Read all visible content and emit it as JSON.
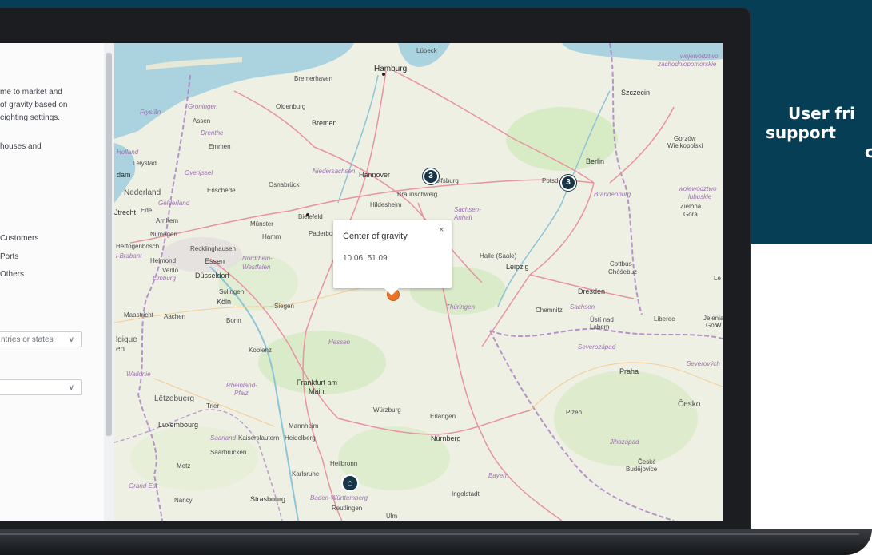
{
  "tagline": {
    "line1": "User fri",
    "line2": "support",
    "line3": "c"
  },
  "sidebar": {
    "desc_lines": [
      "me to market and",
      "of gravity based on",
      "eighting settings."
    ],
    "desc2": "houses and",
    "checkboxes": [
      "Customers",
      "Ports",
      "Others"
    ],
    "select1_placeholder": "ntries or states",
    "select_chevron": "∨"
  },
  "map": {
    "popup": {
      "title": "Center of gravity",
      "coords": "10.06, 51.09",
      "close": "×"
    },
    "clusters": [
      {
        "id": "hannover",
        "count": "3"
      },
      {
        "id": "berlin",
        "count": "3"
      }
    ],
    "icons": {
      "warehouse": "house-icon"
    },
    "labels": {
      "hamburg": "Hamburg",
      "lubeck": "Lübeck",
      "bremerhaven": "Bremerhaven",
      "bremen": "Bremen",
      "oldenburg": "Oldenburg",
      "groningen": "Groningen",
      "assen": "Assen",
      "fryslan": "Fryslân",
      "drenthe": "Drenthe",
      "emmen": "Emmen",
      "holland": "Holland",
      "lelystad": "Lelystad",
      "dam": "dam",
      "overijssel": "Overijssel",
      "niedersachsen": "Niedersachsen",
      "nederland": "Nederland",
      "gelderland": "Gelderland",
      "enschede": "Enschede",
      "osnabruck": "Osnabrück",
      "hannover": "Hannover",
      "wolfsburg": "Wolfsburg",
      "braunschweig": "Braunschweig",
      "hildesheim": "Hildesheim",
      "berlin": "Berlin",
      "potsdam": "Potsd",
      "brandenburg": "Brandenburg",
      "szczecin": "Szczecin",
      "gorzow": "Gorzów",
      "wielkopolski": "Wielkopolski",
      "zachodniopom1": "województwo",
      "zachodniopom2": "zachodniopomorskie",
      "lubuskie1": "województwo",
      "lubuskie2": "lubuskie",
      "zielona1": "Zielona",
      "zielona2": "Góra",
      "utrecht": "Jtrecht",
      "ede": "Ede",
      "arnhem": "Arnhem",
      "munster": "Münster",
      "bielefeld": "Bielefeld",
      "paderborn": "Paderborn",
      "sachsen_anhalt1": "Sachsen-",
      "sachsen_anhalt2": "Anhalt",
      "nijmegen": "Nijmegen",
      "hertogenbosch": "Hertogenbosch",
      "brabant": "l-Brabant",
      "helmond": "Helmond",
      "venlo": "Venlo",
      "limburg": "Limburg",
      "recklinghausen": "Recklinghausen",
      "hamm": "Hamm",
      "essen": "Essen",
      "nrw1": "Nordrhein-",
      "nrw2": "Westfalen",
      "dusseldorf": "Düsseldorf",
      "solingen": "Solingen",
      "koln": "Köln",
      "halle": "Halle (Saale)",
      "leipzig": "Leipzig",
      "cottbus1": "Cottbus",
      "cottbus2": "Chóśebuz",
      "dresden": "Dresden",
      "sachsen": "Sachsen",
      "chemnitz": "Chemnitz",
      "thuringen": "Thüringen",
      "maastricht": "Maastricht",
      "aachen": "Aachen",
      "bonn": "Bonn",
      "siegen": "Siegen",
      "ustinad1": "Ústí nad",
      "ustinad2": "Labem",
      "liberec": "Liberec",
      "jelenia1": "Jelenia",
      "jelenia2": "Góra",
      "belgique": "lgique",
      "en": "en",
      "koblenz": "Koblenz",
      "hessen": "Hessen",
      "severozapad": "Severozápad",
      "severovych": "Severových",
      "wallonie": "Wallonie",
      "rlp1": "Rheinland-",
      "rlp2": "Pfalz",
      "frankfurt1": "Frankfurt am",
      "frankfurt2": "Main",
      "praha": "Praha",
      "letzebuerg": "Lëtzebuerg",
      "trier": "Trier",
      "luxembourg": "Luxembourg",
      "wurzburg": "Würzburg",
      "erlangen": "Erlangen",
      "plzen": "Plzeň",
      "cesko": "Česko",
      "mannheim": "Mannheim",
      "saarland": "Saarland",
      "kaiserslautern": "Kaiserslautern",
      "heidelberg": "Heidelberg",
      "saarbrucken": "Saarbrücken",
      "nurnberg": "Nürnberg",
      "jihozapad": "Jihozápad",
      "metz": "Metz",
      "heilbronn": "Heilbronn",
      "karlsruhe": "Karlsruhe",
      "bayern": "Bayern",
      "ceske1": "České",
      "ceske2": "Budějovice",
      "grandest": "Grand Est",
      "nancy": "Nancy",
      "strasbourg": "Strasbourg",
      "bw": "Baden-Württemberg",
      "reutlingen": "Reutlingen",
      "ulm": "Ulm",
      "ingolstadt": "Ingolstadt",
      "le": "Le",
      "w": "W"
    }
  }
}
